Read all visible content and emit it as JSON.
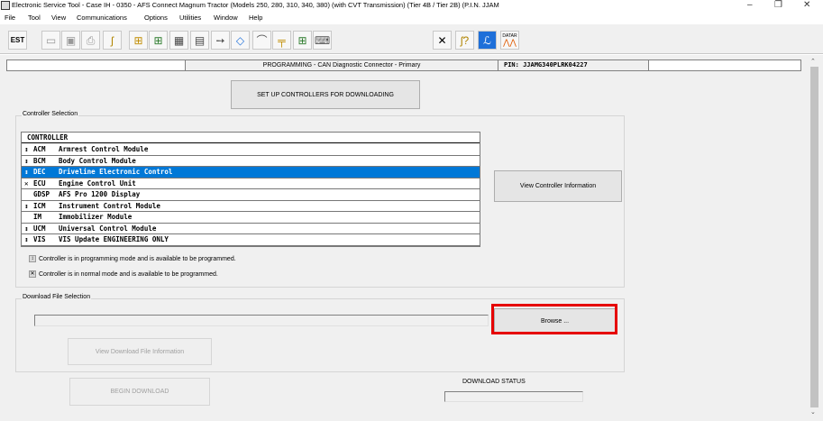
{
  "window": {
    "title": "Electronic Service Tool - Case IH - 0350 - AFS Connect Magnum Tractor (Models 250, 280, 310, 340, 380) (with CVT Transmission) (Tier 4B / Tier 2B) (P.I.N. JJAM",
    "minimize": "–",
    "maximize": "❐",
    "close": "✕"
  },
  "menu": [
    "File",
    "Tool",
    "View",
    "Communications",
    "Options",
    "Utilities",
    "Window",
    "Help"
  ],
  "toolbar": {
    "icons": [
      "est-icon",
      "folder-open-icon",
      "save-icon",
      "print-icon",
      "probe-icon",
      "network-icon",
      "network-alt-icon",
      "module-icon",
      "module-alt-icon",
      "wrench-arrow-icon",
      "diamond-icon",
      "sensor-icon",
      "plug-icon",
      "tree-icon",
      "keyboard-icon",
      "tools-icon",
      "help-probe-icon",
      "settings-icon",
      "datar-icon"
    ],
    "datar_label": "DATAR"
  },
  "status": {
    "program_text": "PROGRAMMING  - CAN Diagnostic Connector - Primary",
    "pin_text": "PIN: JJAMG340PLRK04227"
  },
  "setup_button": "SET UP CONTROLLERS FOR DOWNLOADING",
  "controller_selection": {
    "group_label": "Controller Selection",
    "column_header": "CONTROLLER",
    "rows": [
      {
        "icon": "↕",
        "code": "ACM",
        "name": "Armrest Control Module",
        "selected": false
      },
      {
        "icon": "↕",
        "code": "BCM",
        "name": "Body Control Module",
        "selected": false
      },
      {
        "icon": "↕",
        "code": "DEC",
        "name": "Driveline Electronic Control",
        "selected": true
      },
      {
        "icon": "✕",
        "code": "ECU",
        "name": "Engine Control Unit",
        "selected": false
      },
      {
        "icon": "",
        "code": "GDSP",
        "name": "AFS Pro 1200 Display",
        "selected": false
      },
      {
        "icon": "↕",
        "code": "ICM",
        "name": "Instrument Control Module",
        "selected": false
      },
      {
        "icon": "",
        "code": "IM",
        "name": "Immobilizer Module",
        "selected": false
      },
      {
        "icon": "↕",
        "code": "UCM",
        "name": "Universal Control Module",
        "selected": false
      },
      {
        "icon": "↕",
        "code": "VIS",
        "name": "VIS Update ENGINEERING ONLY",
        "selected": false
      }
    ],
    "view_info_button": "View Controller Information",
    "legend_programming": "Controller is in programming mode and is available to be programmed.",
    "legend_normal": "Controller is in normal mode and is available to be programmed."
  },
  "download": {
    "group_label": "Download File Selection",
    "browse_button": "Browse ...",
    "view_file_info_button": "View Download File Information",
    "begin_button": "BEGIN DOWNLOAD",
    "status_label": "DOWNLOAD STATUS"
  },
  "colors": {
    "selection": "#0078d7",
    "highlight": "#e60000"
  }
}
